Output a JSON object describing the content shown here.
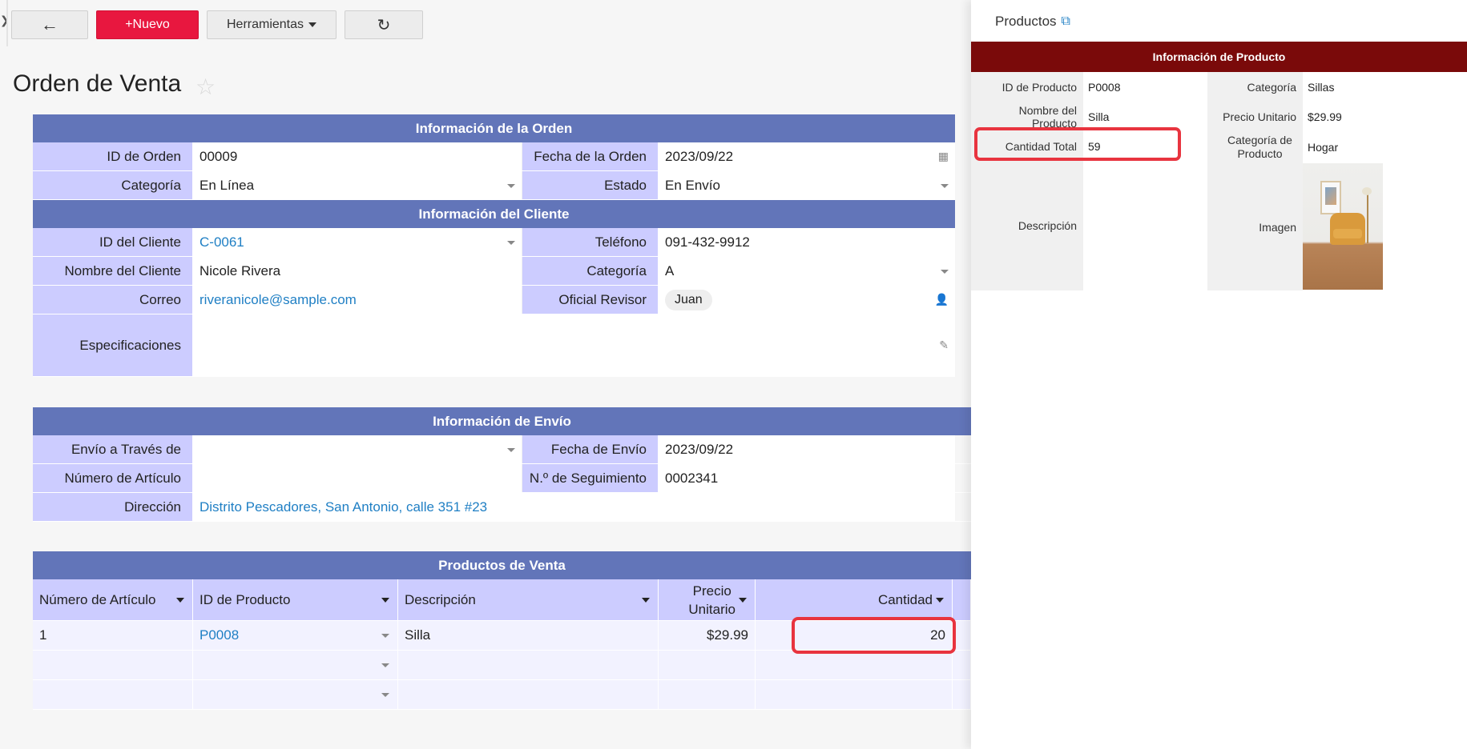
{
  "toolbar": {
    "back_icon": "←",
    "new_label": "+Nuevo",
    "tools_label": "Herramientas",
    "refresh_icon": "↻"
  },
  "page": {
    "title": "Orden de Venta"
  },
  "order_info": {
    "header": "Información de la Orden",
    "id_label": "ID de Orden",
    "id_value": "00009",
    "date_label": "Fecha de la Orden",
    "date_value": "2023/09/22",
    "category_label": "Categoría",
    "category_value": "En Línea",
    "status_label": "Estado",
    "status_value": "En Envío"
  },
  "client_info": {
    "header": "Información del Cliente",
    "id_label": "ID del Cliente",
    "id_value": "C-0061",
    "phone_label": "Teléfono",
    "phone_value": "091-432-9912",
    "name_label": "Nombre del Cliente",
    "name_value": "Nicole Rivera",
    "category_label": "Categoría",
    "category_value": "A",
    "email_label": "Correo",
    "email_value": "riveranicole@sample.com",
    "reviewer_label": "Oficial Revisor",
    "reviewer_value": "Juan",
    "specs_label": "Especificaciones",
    "specs_value": ""
  },
  "shipping_info": {
    "header": "Información de Envío",
    "via_label": "Envío a Través de",
    "via_value": "",
    "ship_date_label": "Fecha de Envío",
    "ship_date_value": "2023/09/22",
    "item_label": "Número de Artículo",
    "item_value": "",
    "tracking_label": "N.º de Seguimiento",
    "tracking_value": "0002341",
    "address_label": "Dirección",
    "address_value": "Distrito Pescadores, San Antonio, calle 351 #23"
  },
  "sales_products": {
    "header": "Productos de Venta",
    "columns": [
      "Número de Artículo",
      "ID de Producto",
      "Descripción",
      "Precio\nUnitario",
      "Cantidad"
    ],
    "rows": [
      {
        "item": "1",
        "product_id": "P0008",
        "description": "Silla",
        "unit_price": "$29.99",
        "quantity": "20"
      }
    ]
  },
  "panel": {
    "title": "Productos",
    "section": "Información de Producto",
    "product_id_label": "ID de Producto",
    "product_id_value": "P0008",
    "category_label": "Categoría",
    "category_value": "Sillas",
    "name_label": "Nombre del Producto",
    "name_value": "Silla",
    "unit_price_label": "Precio Unitario",
    "unit_price_value": "$29.99",
    "total_qty_label": "Cantidad Total",
    "total_qty_value": "59",
    "product_category_label": "Categoría de Producto",
    "product_category_value": "Hogar",
    "description_label": "Descripción",
    "image_label": "Imagen"
  },
  "colors": {
    "primary_header": "#6275b9",
    "label_bg": "#ccccff",
    "new_button": "#e8173f",
    "panel_bar": "#7a0a0a",
    "highlight": "#e8343f",
    "link": "#1f7fc4"
  },
  "icons": [
    "arrow-left-icon",
    "refresh-icon",
    "star-icon",
    "calendar-icon",
    "person-icon",
    "pencil-icon",
    "external-link-icon",
    "chevron-right-icon"
  ]
}
